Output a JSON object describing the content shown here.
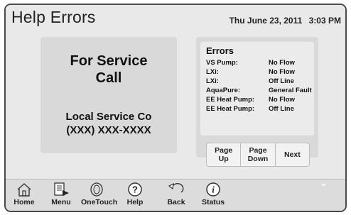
{
  "header": {
    "title": "Help Errors",
    "date": "Thu June 23, 2011",
    "time": "3:03 PM"
  },
  "service": {
    "title_line1": "For Service",
    "title_line2": "Call",
    "company_line1": "Local Service Co",
    "company_line2": "(XXX) XXX-XXXX"
  },
  "errors": {
    "title": "Errors",
    "rows": [
      {
        "label": "VS Pump:",
        "value": "No Flow"
      },
      {
        "label": "LXi:",
        "value": "No Flow"
      },
      {
        "label": "LXi:",
        "value": "Off Line"
      },
      {
        "label": "AquaPure:",
        "value": "General Fault"
      },
      {
        "label": "EE Heat Pump:",
        "value": "No Flow"
      },
      {
        "label": "EE Heat Pump:",
        "value": "Off Line"
      }
    ]
  },
  "pager": {
    "page_up": "Page\nUp",
    "page_down": "Page\nDown",
    "next": "Next"
  },
  "nav": {
    "home": "Home",
    "menu": "Menu",
    "onetouch": "OneTouch",
    "help": "Help",
    "back": "Back",
    "status": "Status"
  },
  "colors": {
    "frame": "#4a4a4a",
    "background": "#e9e9e9",
    "panel": "#d9d9d9",
    "footer": "#dcdcdc"
  }
}
